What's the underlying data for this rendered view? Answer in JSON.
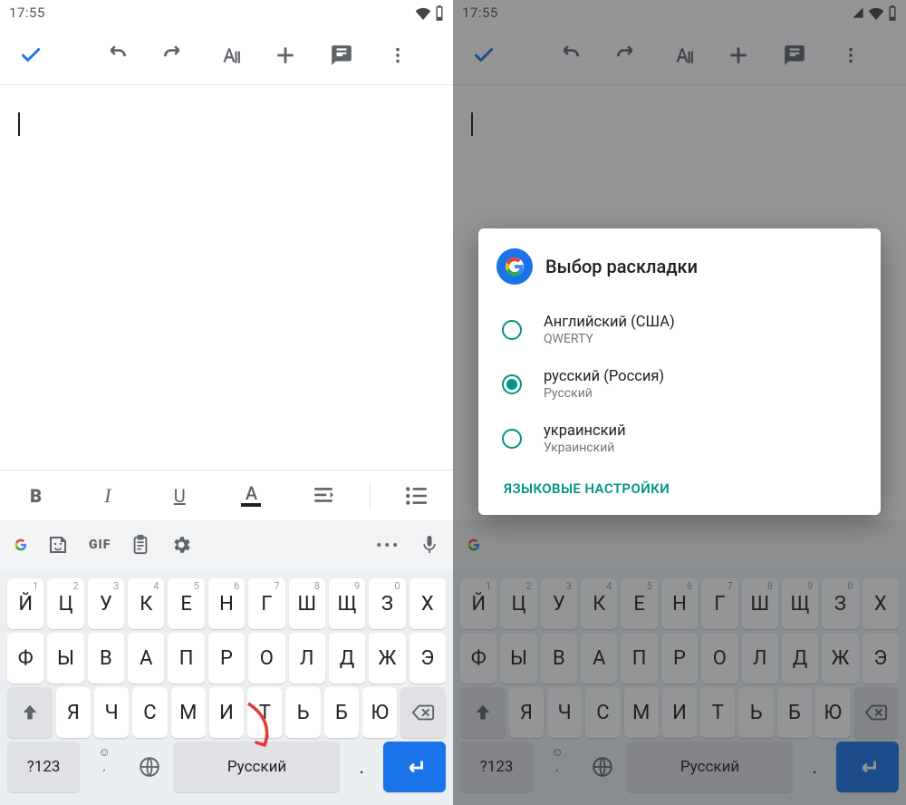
{
  "status": {
    "time": "17:55"
  },
  "editor": {
    "content": ""
  },
  "format": {
    "bold": "B",
    "italic": "I",
    "underline": "U",
    "textcolor": "A"
  },
  "suggest": {
    "gif": "GIF",
    "more": "•••"
  },
  "keyboard": {
    "row1": [
      {
        "ch": "Й",
        "n": "1"
      },
      {
        "ch": "Ц",
        "n": "2"
      },
      {
        "ch": "У",
        "n": "3"
      },
      {
        "ch": "К",
        "n": "4"
      },
      {
        "ch": "Е",
        "n": "5"
      },
      {
        "ch": "Н",
        "n": "6"
      },
      {
        "ch": "Г",
        "n": "7"
      },
      {
        "ch": "Ш",
        "n": "8"
      },
      {
        "ch": "Щ",
        "n": "9"
      },
      {
        "ch": "З",
        "n": "0"
      },
      {
        "ch": "Х",
        "n": ""
      }
    ],
    "row2": [
      "Ф",
      "Ы",
      "В",
      "А",
      "П",
      "Р",
      "О",
      "Л",
      "Д",
      "Ж",
      "Э"
    ],
    "row3": [
      "Я",
      "Ч",
      "С",
      "М",
      "И",
      "Т",
      "Ь",
      "Б",
      "Ю"
    ],
    "sym": "?123",
    "space": "Русский",
    "dot": "."
  },
  "dialog": {
    "title": "Выбор раскладки",
    "options": [
      {
        "main": "Английский (США)",
        "sub": "QWERTY",
        "selected": false
      },
      {
        "main": "русский (Россия)",
        "sub": "Русский",
        "selected": true
      },
      {
        "main": "украинский",
        "sub": "Украинский",
        "selected": false
      }
    ],
    "action": "ЯЗЫКОВЫЕ НАСТРОЙКИ"
  }
}
